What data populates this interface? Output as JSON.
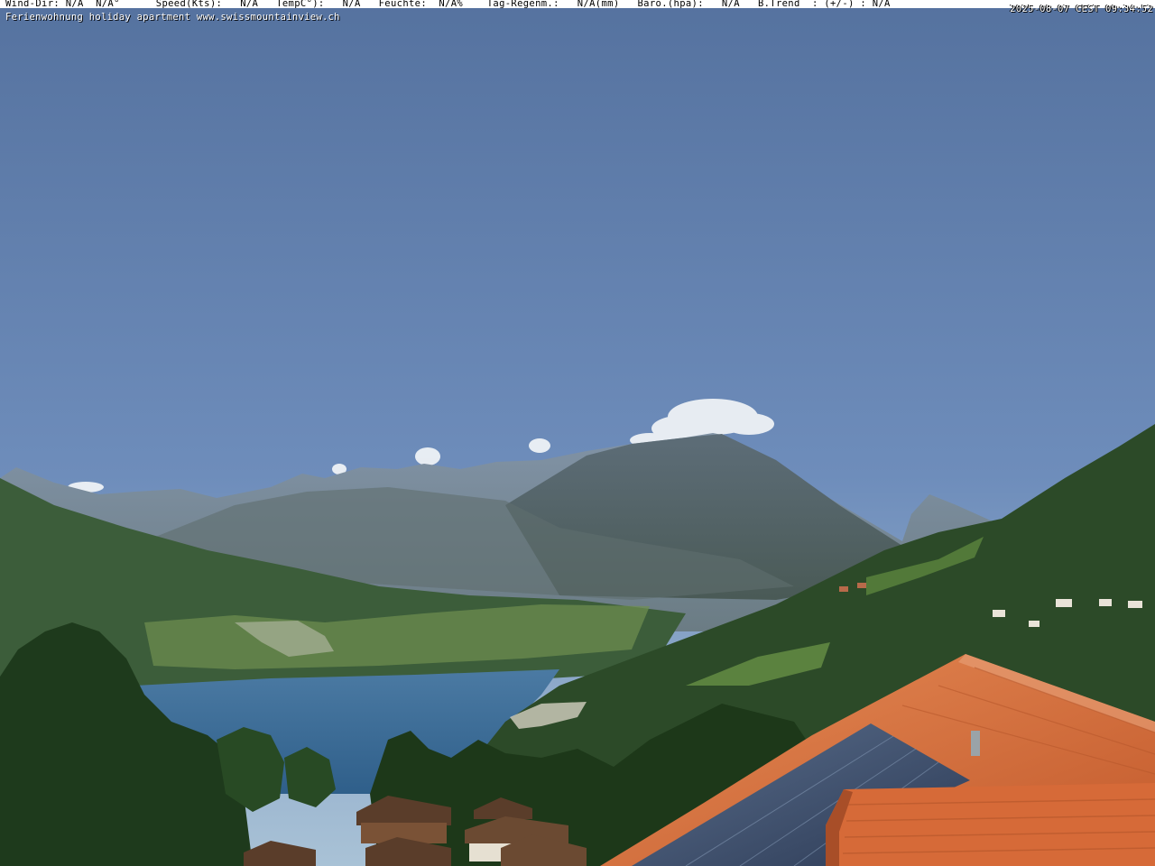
{
  "overlay": {
    "weather_line": "Wind-Dir: N/A  N/A°      Speed(Kts):   N/A   TempC°):   N/A   Feuchte:  N/A%    Tag-Regenm.:   N/A(mm)   Baro.(hpa):   N/A   B.Trend  : (+/-) : N/A",
    "timestamp": "2025-08-07 CEST 09:34:52",
    "caption": "Ferienwohnung holiday apartment www.swissmountainview.ch"
  },
  "colors": {
    "sky_top": "#5674a8",
    "sky_horizon": "#a7c0d4",
    "lake": "#3f6f9a",
    "roof": "#d9703f",
    "forest": "#23421f"
  }
}
